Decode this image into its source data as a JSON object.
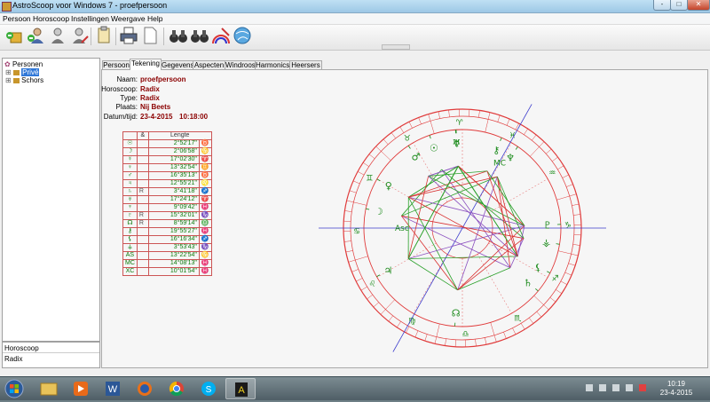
{
  "window": {
    "title": "AstroScoop voor Windows 7 - proefpersoon",
    "min_label": "-",
    "max_label": "□",
    "close_label": "✕"
  },
  "menu": [
    "Persoon",
    "Horoscoop",
    "Instellingen",
    "Weergave",
    "Help"
  ],
  "toolbar": {
    "icons": [
      "new-person-icon",
      "add-person-icon",
      "person-icon",
      "edit-person-icon",
      "copy-icon",
      "print-icon",
      "page-icon",
      "binoculars-icon",
      "binoculars-icon",
      "rainbow-icon",
      "globe-icon"
    ]
  },
  "tree": {
    "root": "Personen",
    "children": [
      "Privé",
      "Schors"
    ]
  },
  "left_lower": [
    "Horoscoop",
    "Radix"
  ],
  "tabs": [
    "Persoon",
    "Tekening",
    "Gegevens",
    "Aspecten",
    "Windroos",
    "Harmonics",
    "Heersers"
  ],
  "active_tab": "Tekening",
  "info": {
    "name_label": "Naam:",
    "name": "proefpersoon",
    "horoscope_label": "Horoscoop:",
    "horoscope": "Radix",
    "type_label": "Type:",
    "type": "Radix",
    "place_label": "Plaats:",
    "place": "Nij Beets",
    "datetime_label": "Datum/tijd:",
    "date": "23-4-2015",
    "time": "10:18:00"
  },
  "positions": {
    "header_glyph": "&",
    "header": "Lengte",
    "rows": [
      {
        "planet": "☉",
        "retro": "",
        "value": "2°52'17\"",
        "sign": "♉"
      },
      {
        "planet": "☽",
        "retro": "",
        "value": "2°06'58\"",
        "sign": "♋"
      },
      {
        "planet": "☿",
        "retro": "",
        "value": "17°02'30\"",
        "sign": "♈"
      },
      {
        "planet": "♀",
        "retro": "",
        "value": "13°32'54\"",
        "sign": "♊"
      },
      {
        "planet": "♂",
        "retro": "",
        "value": "16°35'13\"",
        "sign": "♉"
      },
      {
        "planet": "♃",
        "retro": "",
        "value": "12°55'21\"",
        "sign": "♌"
      },
      {
        "planet": "♄",
        "retro": "R",
        "value": "3°41'18\"",
        "sign": "♐"
      },
      {
        "planet": "♅",
        "retro": "",
        "value": "17°24'12\"",
        "sign": "♈"
      },
      {
        "planet": "♆",
        "retro": "",
        "value": "9°09'42\"",
        "sign": "♓"
      },
      {
        "planet": "♇",
        "retro": "R",
        "value": "15°32'01\"",
        "sign": "♑"
      },
      {
        "planet": "☊",
        "retro": "R",
        "value": "8°59'14\"",
        "sign": "♎"
      },
      {
        "planet": "⚷",
        "retro": "",
        "value": "19°55'27\"",
        "sign": "♓"
      },
      {
        "planet": "⚸",
        "retro": "",
        "value": "16°16'34\"",
        "sign": "♐"
      },
      {
        "planet": "⚶",
        "retro": "",
        "value": "3°53'43\"",
        "sign": "♑"
      },
      {
        "planet": "AS",
        "retro": "",
        "value": "13°22'54\"",
        "sign": "♋"
      },
      {
        "planet": "MC",
        "retro": "",
        "value": "14°08'13\"",
        "sign": "♓"
      },
      {
        "planet": "XC",
        "retro": "",
        "value": "10°01'54\"",
        "sign": "♓"
      }
    ]
  },
  "chart": {
    "zodiac": [
      "♈",
      "♉",
      "♊",
      "♋",
      "♌",
      "♍",
      "♎",
      "♏",
      "♐",
      "♑",
      "♒",
      "♓"
    ],
    "labels": {
      "asc": "Asc",
      "mc": "MC"
    },
    "colors": {
      "ring": "#e03a3a",
      "axis": "#3c3ccc",
      "glyph": "#1a8a1a",
      "aspect_green": "#2aa02a",
      "aspect_red": "#d93030",
      "aspect_purple": "#8a4fbf"
    }
  },
  "taskbar": {
    "apps": [
      "start-orb-icon",
      "explorer-icon",
      "media-player-icon",
      "word-icon",
      "firefox-icon",
      "chrome-icon",
      "skype-icon",
      "astroscoop-icon"
    ],
    "time": "10:19",
    "date": "23-4-2015"
  }
}
